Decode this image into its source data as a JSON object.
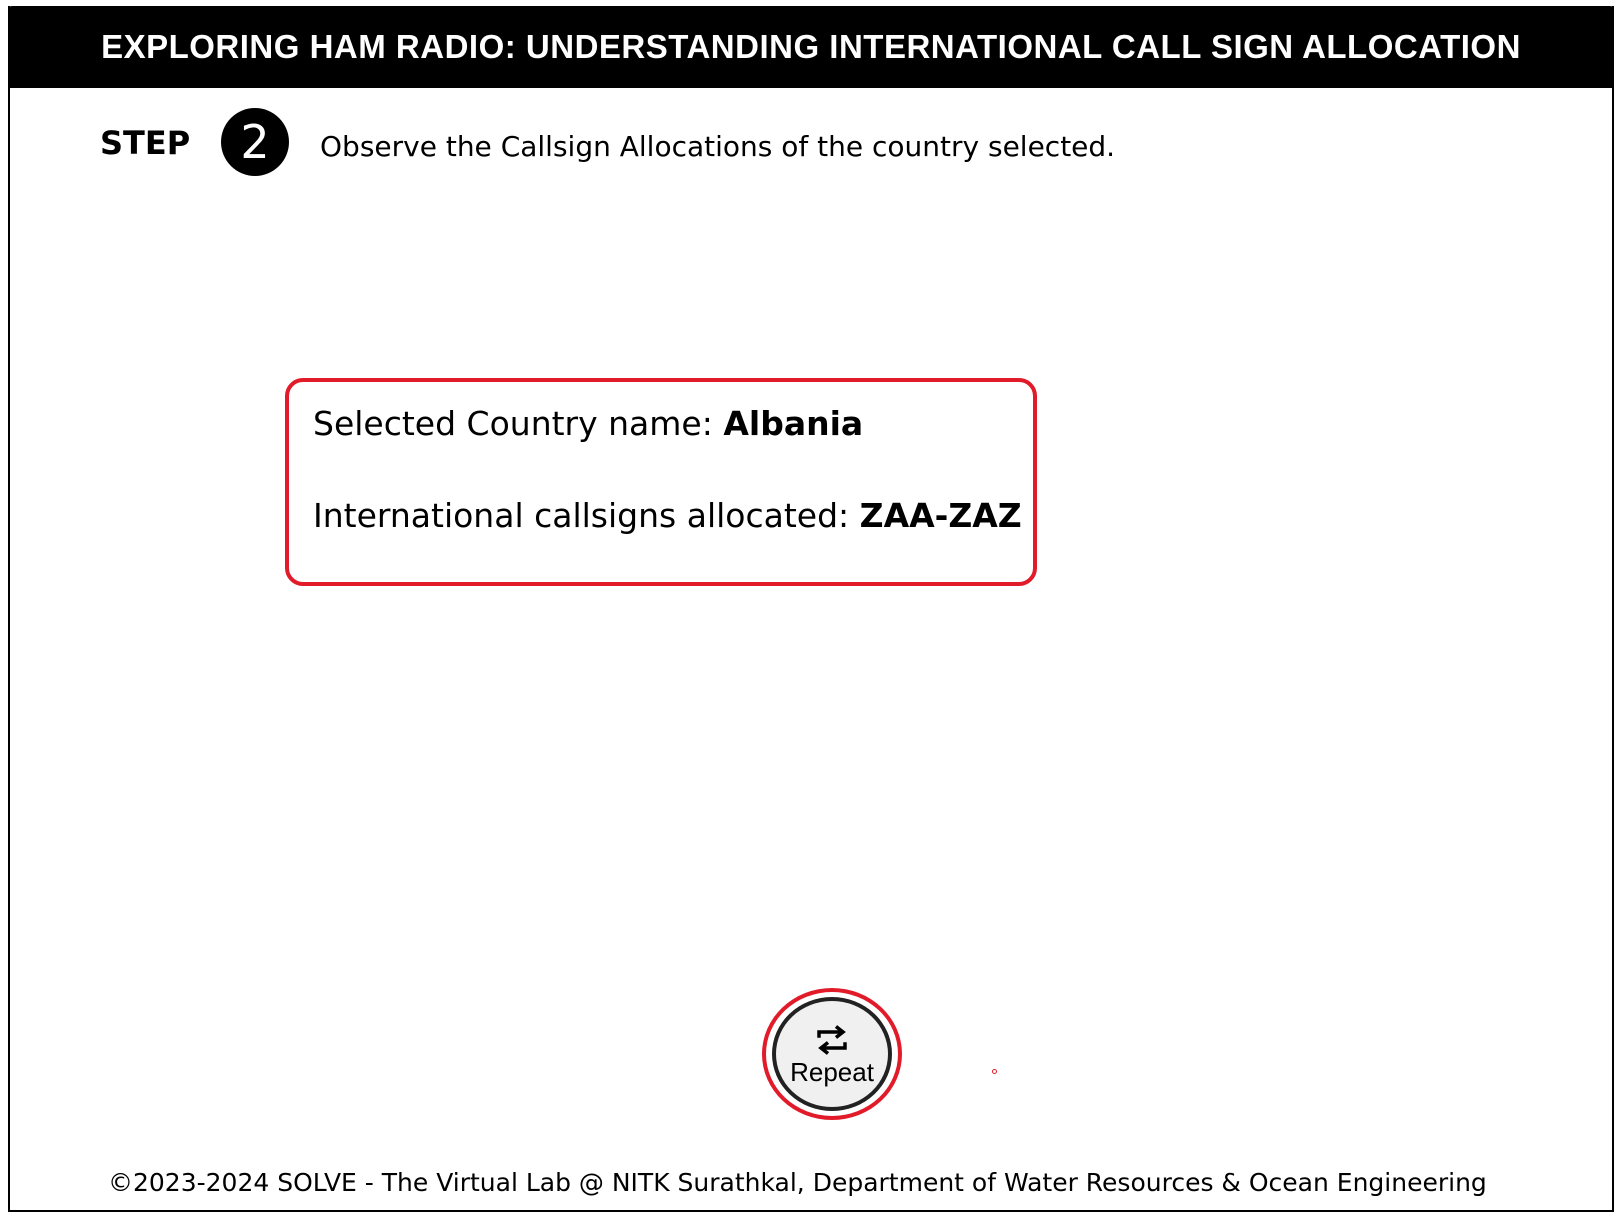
{
  "header": {
    "title": "EXPLORING HAM RADIO: UNDERSTANDING INTERNATIONAL CALL SIGN ALLOCATION"
  },
  "step": {
    "label": "STEP",
    "number": "2",
    "instruction": "Observe the Callsign Allocations of the country selected."
  },
  "info": {
    "country_label": "Selected Country name:",
    "country_value": "Albania",
    "callsign_label": "International callsigns allocated:",
    "callsign_value": "ZAA-ZAZ"
  },
  "repeat_button": {
    "label": "Repeat",
    "icon": "repeat-icon"
  },
  "footer": {
    "text": "©2023-2024 SOLVE - The Virtual Lab @ NITK Surathkal, Department of Water Resources & Ocean Engineering"
  },
  "colors": {
    "accent_red": "#e21b2a",
    "header_bg": "#000000",
    "header_text": "#ffffff"
  }
}
